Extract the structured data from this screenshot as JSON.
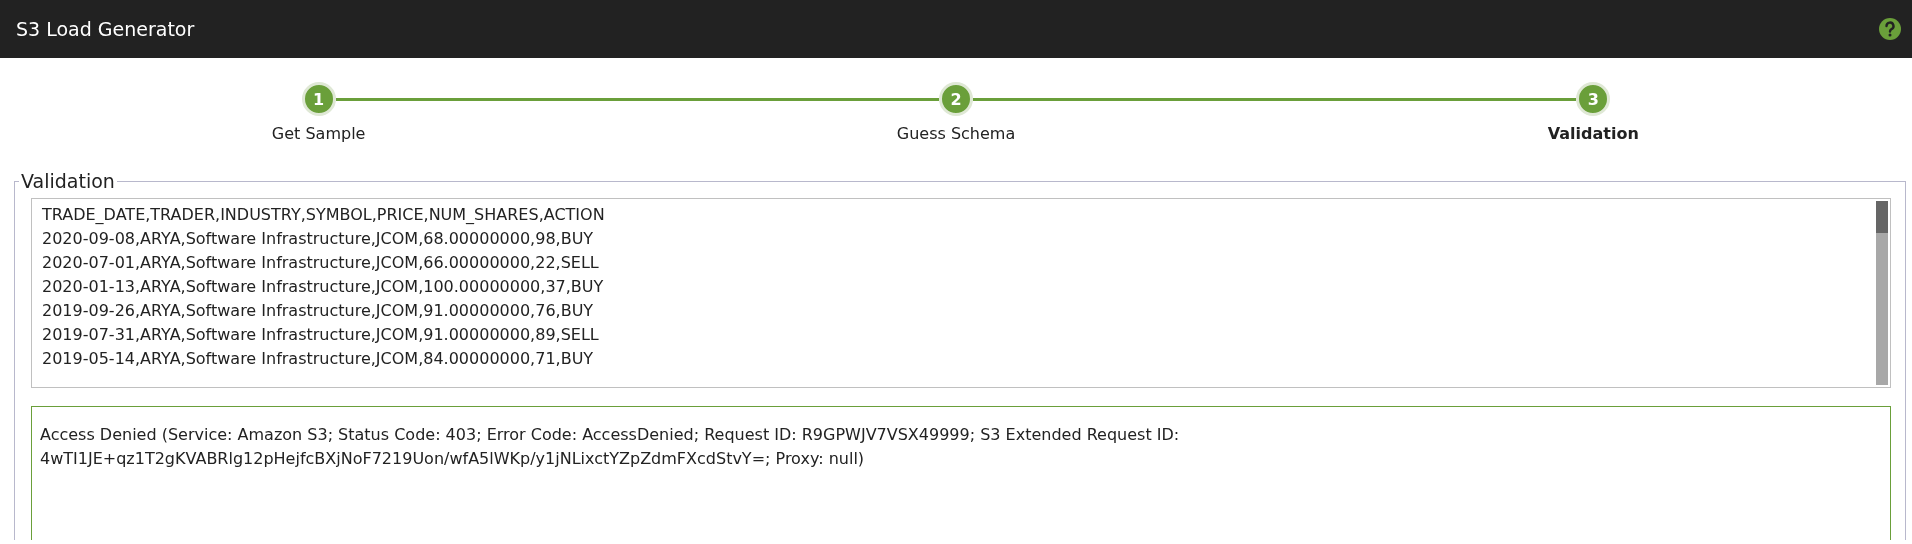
{
  "header": {
    "title": "S3 Load Generator"
  },
  "steps": [
    {
      "number": "1",
      "label": "Get Sample",
      "selected": false
    },
    {
      "number": "2",
      "label": "Guess Schema",
      "selected": false
    },
    {
      "number": "3",
      "label": "Validation",
      "selected": true
    }
  ],
  "validation": {
    "legend": "Validation",
    "sample_lines": [
      "TRADE_DATE,TRADER,INDUSTRY,SYMBOL,PRICE,NUM_SHARES,ACTION",
      "2020-09-08,ARYA,Software Infrastructure,JCOM,68.00000000,98,BUY",
      "2020-07-01,ARYA,Software Infrastructure,JCOM,66.00000000,22,SELL",
      "2020-01-13,ARYA,Software Infrastructure,JCOM,100.00000000,37,BUY",
      "2019-09-26,ARYA,Software Infrastructure,JCOM,91.00000000,76,BUY",
      "2019-07-31,ARYA,Software Infrastructure,JCOM,91.00000000,89,SELL",
      "2019-05-14,ARYA,Software Infrastructure,JCOM,84.00000000,71,BUY"
    ],
    "error": "Access Denied (Service: Amazon S3; Status Code: 403; Error Code: AccessDenied; Request ID: R9GPWJV7VSX49999; S3 Extended Request ID: 4wTI1JE+qz1T2gKVABRlg12pHejfcBXjNoF7219Uon/wfA5lWKp/y1jNLixctYZpZdmFXcdStvY=; Proxy: null)"
  }
}
